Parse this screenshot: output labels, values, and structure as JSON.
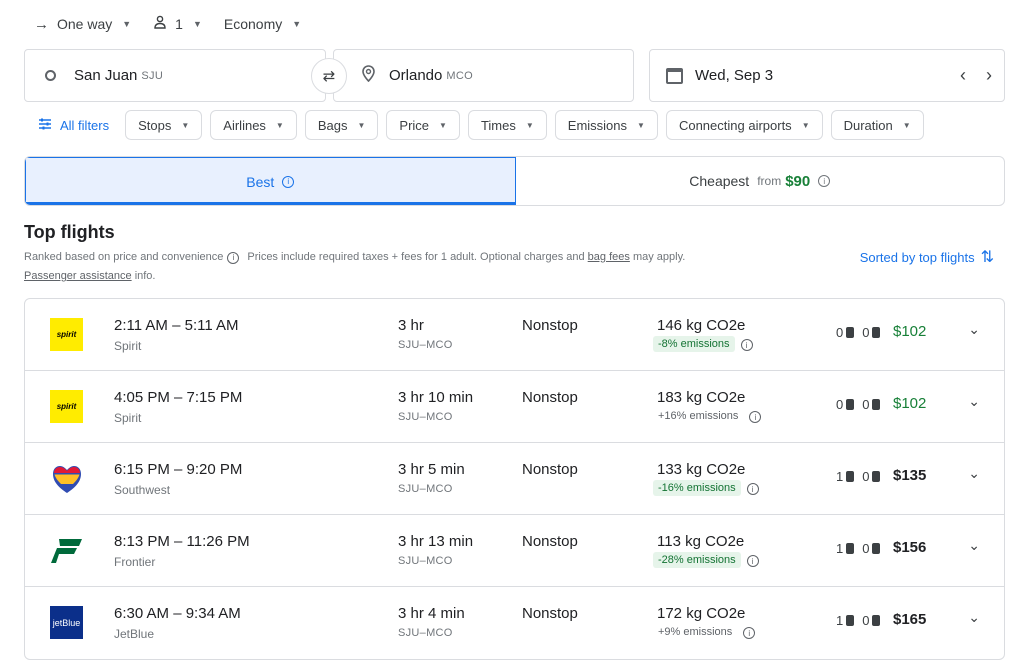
{
  "top": {
    "trip_type": "One way",
    "passengers": "1",
    "cabin": "Economy"
  },
  "search": {
    "origin": "San Juan",
    "origin_code": "SJU",
    "destination": "Orlando",
    "destination_code": "MCO",
    "date": "Wed, Sep 3"
  },
  "filters": {
    "all": "All filters",
    "chips": [
      "Stops",
      "Airlines",
      "Bags",
      "Price",
      "Times",
      "Emissions",
      "Connecting airports",
      "Duration"
    ]
  },
  "tabs": {
    "best": "Best",
    "cheapest": "Cheapest",
    "from_label": "from",
    "cheapest_price": "$90"
  },
  "heading": {
    "title": "Top flights",
    "ranked": "Ranked based on price and convenience",
    "prices_note": "Prices include required taxes + fees for 1 adult. Optional charges and",
    "bag_fees": "bag fees",
    "may_apply": "may apply.",
    "assistance": "Passenger assistance",
    "info": "info.",
    "sorted": "Sorted by top flights"
  },
  "flights": [
    {
      "times": "2:11 AM – 5:11 AM",
      "airline": "Spirit",
      "logo_text": "spirit",
      "duration": "3 hr",
      "route": "SJU–MCO",
      "stops": "Nonstop",
      "co2": "146 kg CO2e",
      "emissions": "-8% emissions",
      "good": true,
      "carry": "0",
      "checked": "0",
      "price": "$102",
      "green": true
    },
    {
      "times": "4:05 PM – 7:15 PM",
      "airline": "Spirit",
      "logo_text": "spirit",
      "duration": "3 hr 10 min",
      "route": "SJU–MCO",
      "stops": "Nonstop",
      "co2": "183 kg CO2e",
      "emissions": "+16% emissions",
      "good": false,
      "carry": "0",
      "checked": "0",
      "price": "$102",
      "green": true
    },
    {
      "times": "6:15 PM – 9:20 PM",
      "airline": "Southwest",
      "logo_text": "",
      "duration": "3 hr 5 min",
      "route": "SJU–MCO",
      "stops": "Nonstop",
      "co2": "133 kg CO2e",
      "emissions": "-16% emissions",
      "good": true,
      "carry": "1",
      "checked": "0",
      "price": "$135",
      "green": false
    },
    {
      "times": "8:13 PM – 11:26 PM",
      "airline": "Frontier",
      "logo_text": "",
      "duration": "3 hr 13 min",
      "route": "SJU–MCO",
      "stops": "Nonstop",
      "co2": "113 kg CO2e",
      "emissions": "-28% emissions",
      "good": true,
      "carry": "1",
      "checked": "0",
      "price": "$156",
      "green": false
    },
    {
      "times": "6:30 AM – 9:34 AM",
      "airline": "JetBlue",
      "logo_text": "jetBlue",
      "duration": "3 hr 4 min",
      "route": "SJU–MCO",
      "stops": "Nonstop",
      "co2": "172 kg CO2e",
      "emissions": "+9% emissions",
      "good": false,
      "carry": "1",
      "checked": "0",
      "price": "$165",
      "green": false
    }
  ],
  "colors": {
    "accent": "#1a73e8",
    "green": "#188038",
    "spirit": "#ffec00",
    "frontier": "#006a3b",
    "jetblue": "#0b2f8a"
  }
}
